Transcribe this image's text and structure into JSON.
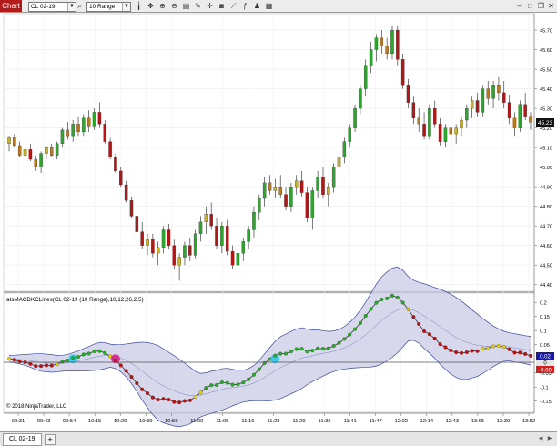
{
  "window": {
    "tab_label": "Chart",
    "instrument": "CL 02-19",
    "period": "10 Range",
    "tools": [
      "bars-icon",
      "zoom-icon",
      "zoom-in-icon",
      "zoom-out-icon",
      "text-icon",
      "pencil-icon",
      "line-icon",
      "marker-icon",
      "measure-icon",
      "list-icon",
      "camera-icon",
      "indicator-icon",
      "strategy-icon",
      "data-box-icon",
      "properties-icon"
    ]
  },
  "colors": {
    "up": "#2fa52f",
    "down": "#b01818",
    "up_weak": "#c8b22a",
    "down_weak": "#b97a1e",
    "band_fill": "#c9cbe6",
    "band_line": "#3c4a9a",
    "dot_up": "#22b022",
    "dot_down": "#c01010",
    "dot_neutral": "#e8d000",
    "cyan_marker": "#2cc6e8",
    "magenta_marker": "#d81a86",
    "price_badge": "#111111",
    "macd_badge_top": "#1a1aa0",
    "macd_badge_bottom": "#d02020"
  },
  "price_panel": {
    "y_ticks": [
      "45.70",
      "45.60",
      "45.50",
      "45.40",
      "45.30",
      "45.20",
      "45.10",
      "45.00",
      "44.90",
      "44.80",
      "44.70",
      "44.60",
      "44.50",
      "44.40"
    ],
    "last_price": "45.23"
  },
  "indicator_panel": {
    "label": "atsMACDKCLines(CL 02-19 (10 Range),10,12,26,2.5)",
    "y_ticks": [
      "0.2",
      "0.15",
      "0.1",
      "0.05",
      "-0.05",
      "-0.1",
      "-0.15"
    ],
    "badge_top": "0.02",
    "badge_mid": "0",
    "badge_bottom": "-0.00",
    "copyright": "© 2018 NinjaTrader, LLC"
  },
  "time_axis": [
    "09:31",
    "09:43",
    "09:54",
    "10:15",
    "10:29",
    "10:39",
    "10:59",
    "11:00",
    "11:05",
    "11:16",
    "11:23",
    "11:29",
    "11:35",
    "11:41",
    "11:47",
    "12:02",
    "12:14",
    "12:43",
    "13:05",
    "13:30",
    "13:52"
  ],
  "bottom": {
    "tab": "CL 02-19",
    "add": "+"
  },
  "chart_data": {
    "type": "candlestick",
    "y_range": [
      44.38,
      45.77
    ],
    "candles": [
      [
        45.12,
        45.16,
        45.08,
        45.15
      ],
      [
        45.15,
        45.17,
        45.1,
        45.11
      ],
      [
        45.11,
        45.13,
        45.05,
        45.06
      ],
      [
        45.06,
        45.1,
        45.02,
        45.09
      ],
      [
        45.09,
        45.12,
        45.03,
        45.04
      ],
      [
        45.04,
        45.06,
        44.98,
        45.0
      ],
      [
        45.0,
        45.08,
        44.97,
        45.07
      ],
      [
        45.07,
        45.11,
        45.04,
        45.1
      ],
      [
        45.1,
        45.12,
        45.05,
        45.06
      ],
      [
        45.06,
        45.13,
        45.04,
        45.12
      ],
      [
        45.12,
        45.2,
        45.1,
        45.19
      ],
      [
        45.19,
        45.23,
        45.14,
        45.16
      ],
      [
        45.16,
        45.24,
        45.13,
        45.22
      ],
      [
        45.22,
        45.26,
        45.16,
        45.18
      ],
      [
        45.18,
        45.27,
        45.16,
        45.25
      ],
      [
        45.25,
        45.29,
        45.18,
        45.21
      ],
      [
        45.21,
        45.3,
        45.19,
        45.28
      ],
      [
        45.28,
        45.33,
        45.2,
        45.22
      ],
      [
        45.22,
        45.24,
        45.12,
        45.13
      ],
      [
        45.13,
        45.15,
        45.04,
        45.05
      ],
      [
        45.05,
        45.07,
        44.97,
        44.98
      ],
      [
        44.98,
        45.0,
        44.9,
        44.91
      ],
      [
        44.91,
        44.93,
        44.82,
        44.83
      ],
      [
        44.83,
        44.85,
        44.74,
        44.75
      ],
      [
        44.75,
        44.78,
        44.66,
        44.67
      ],
      [
        44.67,
        44.72,
        44.58,
        44.6
      ],
      [
        44.6,
        44.66,
        44.55,
        44.63
      ],
      [
        44.63,
        44.66,
        44.54,
        44.56
      ],
      [
        44.56,
        44.62,
        44.5,
        44.59
      ],
      [
        44.59,
        44.7,
        44.56,
        44.68
      ],
      [
        44.68,
        44.71,
        44.58,
        44.6
      ],
      [
        44.6,
        44.63,
        44.48,
        44.5
      ],
      [
        44.5,
        44.56,
        44.42,
        44.54
      ],
      [
        44.54,
        44.62,
        44.5,
        44.6
      ],
      [
        44.6,
        44.64,
        44.52,
        44.55
      ],
      [
        44.55,
        44.68,
        44.53,
        44.66
      ],
      [
        44.66,
        44.75,
        44.62,
        44.72
      ],
      [
        44.72,
        44.8,
        44.66,
        44.76
      ],
      [
        44.76,
        44.82,
        44.68,
        44.7
      ],
      [
        44.7,
        44.74,
        44.58,
        44.6
      ],
      [
        44.6,
        44.72,
        44.56,
        44.7
      ],
      [
        44.7,
        44.73,
        44.55,
        44.57
      ],
      [
        44.57,
        44.6,
        44.48,
        44.5
      ],
      [
        44.5,
        44.58,
        44.44,
        44.56
      ],
      [
        44.56,
        44.64,
        44.52,
        44.62
      ],
      [
        44.62,
        44.7,
        44.58,
        44.68
      ],
      [
        44.68,
        44.8,
        44.64,
        44.77
      ],
      [
        44.77,
        44.86,
        44.73,
        44.84
      ],
      [
        44.84,
        44.95,
        44.8,
        44.92
      ],
      [
        44.92,
        44.96,
        44.86,
        44.88
      ],
      [
        44.88,
        44.94,
        44.84,
        44.9
      ],
      [
        44.9,
        44.96,
        44.84,
        44.86
      ],
      [
        44.86,
        44.9,
        44.78,
        44.8
      ],
      [
        44.8,
        44.92,
        44.77,
        44.9
      ],
      [
        44.9,
        44.96,
        44.86,
        44.93
      ],
      [
        44.93,
        44.98,
        44.85,
        44.87
      ],
      [
        44.87,
        44.9,
        44.72,
        44.74
      ],
      [
        44.74,
        44.9,
        44.68,
        44.88
      ],
      [
        44.88,
        44.98,
        44.84,
        44.95
      ],
      [
        44.95,
        45.0,
        44.84,
        44.86
      ],
      [
        44.86,
        44.92,
        44.8,
        44.9
      ],
      [
        44.9,
        45.02,
        44.87,
        45.0
      ],
      [
        45.0,
        45.08,
        44.96,
        45.05
      ],
      [
        45.05,
        45.15,
        45.02,
        45.13
      ],
      [
        45.13,
        45.22,
        45.1,
        45.2
      ],
      [
        45.2,
        45.32,
        45.18,
        45.3
      ],
      [
        45.3,
        45.42,
        45.27,
        45.4
      ],
      [
        45.4,
        45.55,
        45.36,
        45.52
      ],
      [
        45.52,
        45.64,
        45.48,
        45.6
      ],
      [
        45.6,
        45.68,
        45.54,
        45.66
      ],
      [
        45.66,
        45.7,
        45.58,
        45.62
      ],
      [
        45.62,
        45.66,
        45.55,
        45.58
      ],
      [
        45.58,
        45.72,
        45.55,
        45.7
      ],
      [
        45.7,
        45.72,
        45.52,
        45.55
      ],
      [
        45.55,
        45.58,
        45.4,
        45.42
      ],
      [
        45.42,
        45.45,
        45.3,
        45.33
      ],
      [
        45.33,
        45.36,
        45.22,
        45.25
      ],
      [
        45.25,
        45.3,
        45.18,
        45.22
      ],
      [
        45.22,
        45.28,
        45.14,
        45.16
      ],
      [
        45.16,
        45.32,
        45.14,
        45.3
      ],
      [
        45.3,
        45.34,
        45.2,
        45.22
      ],
      [
        45.22,
        45.25,
        45.11,
        45.13
      ],
      [
        45.13,
        45.22,
        45.1,
        45.2
      ],
      [
        45.2,
        45.24,
        45.14,
        45.17
      ],
      [
        45.17,
        45.22,
        45.12,
        45.2
      ],
      [
        45.2,
        45.26,
        45.16,
        45.24
      ],
      [
        45.24,
        45.32,
        45.2,
        45.3
      ],
      [
        45.3,
        45.36,
        45.25,
        45.34
      ],
      [
        45.34,
        45.38,
        45.26,
        45.28
      ],
      [
        45.28,
        45.42,
        45.26,
        45.4
      ],
      [
        45.4,
        45.44,
        45.32,
        45.35
      ],
      [
        45.35,
        45.44,
        45.3,
        45.42
      ],
      [
        45.42,
        45.46,
        45.34,
        45.38
      ],
      [
        45.38,
        45.44,
        45.3,
        45.33
      ],
      [
        45.33,
        45.37,
        45.22,
        45.25
      ],
      [
        45.25,
        45.28,
        45.16,
        45.2
      ],
      [
        45.2,
        45.34,
        45.18,
        45.32
      ],
      [
        45.32,
        45.38,
        45.24,
        45.26
      ],
      [
        45.26,
        45.28,
        45.19,
        45.23
      ]
    ]
  }
}
